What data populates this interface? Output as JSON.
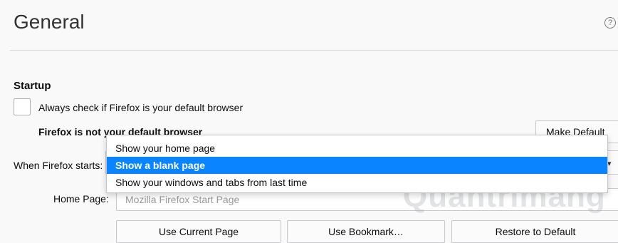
{
  "page": {
    "title": "General"
  },
  "help": {
    "icon": "help-circle-icon",
    "glyph": "?"
  },
  "startup": {
    "section_title": "Startup",
    "always_check_label": "Always check if Firefox is your default browser",
    "always_check_checked": false,
    "not_default_text": "Firefox is not your default browser",
    "make_default_label": "Make Default",
    "when_starts_label": "When Firefox starts:",
    "select_options": [
      "Show your home page",
      "Show a blank page",
      "Show your windows and tabs from last time"
    ],
    "selected_option": "Show a blank page",
    "select_arrow": "▾"
  },
  "home": {
    "label": "Home Page:",
    "placeholder": "Mozilla Firefox Start Page",
    "use_current_label": "Use Current Page",
    "use_bookmark_label": "Use Bookmark…",
    "restore_label": "Restore to Default"
  },
  "watermark": "Quantrimang",
  "colors": {
    "accent": "#0a84ff"
  }
}
